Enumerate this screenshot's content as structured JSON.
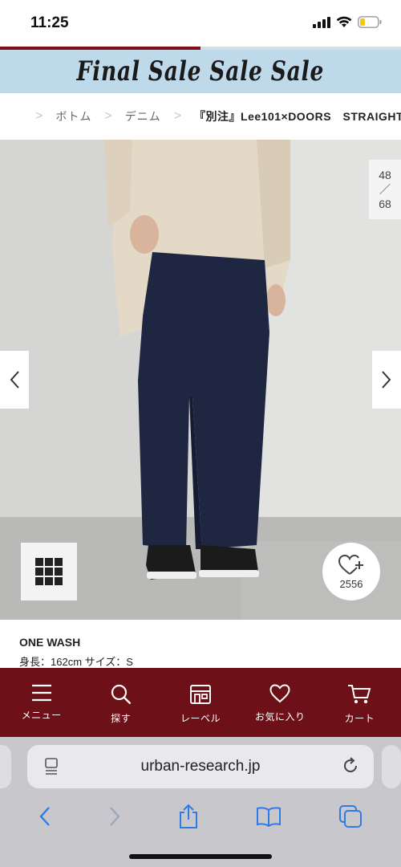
{
  "status": {
    "time": "11:25"
  },
  "progress": {
    "value": 0.5
  },
  "banner": {
    "text": "Final Sale Sale Sale"
  },
  "breadcrumb": {
    "home_icon": "home-icon",
    "items": [
      "ボトム",
      "デニム"
    ],
    "current": "『別注』Lee101×DOORS　STRAIGHT"
  },
  "gallery": {
    "counter_current": "48",
    "counter_sep": "／",
    "counter_total": "68",
    "favorite_count": "2556"
  },
  "product": {
    "title": "ONE WASH",
    "spec": "身長：162cm サイズ：S"
  },
  "nav": {
    "menu": "メニュー",
    "search": "探す",
    "label": "レーベル",
    "favorites": "お気に入り",
    "cart": "カート"
  },
  "browser": {
    "url": "urban-research.jp"
  },
  "colors": {
    "brand": "#6e1018",
    "banner": "#bed9ea",
    "ios_blue": "#2f7be6"
  }
}
